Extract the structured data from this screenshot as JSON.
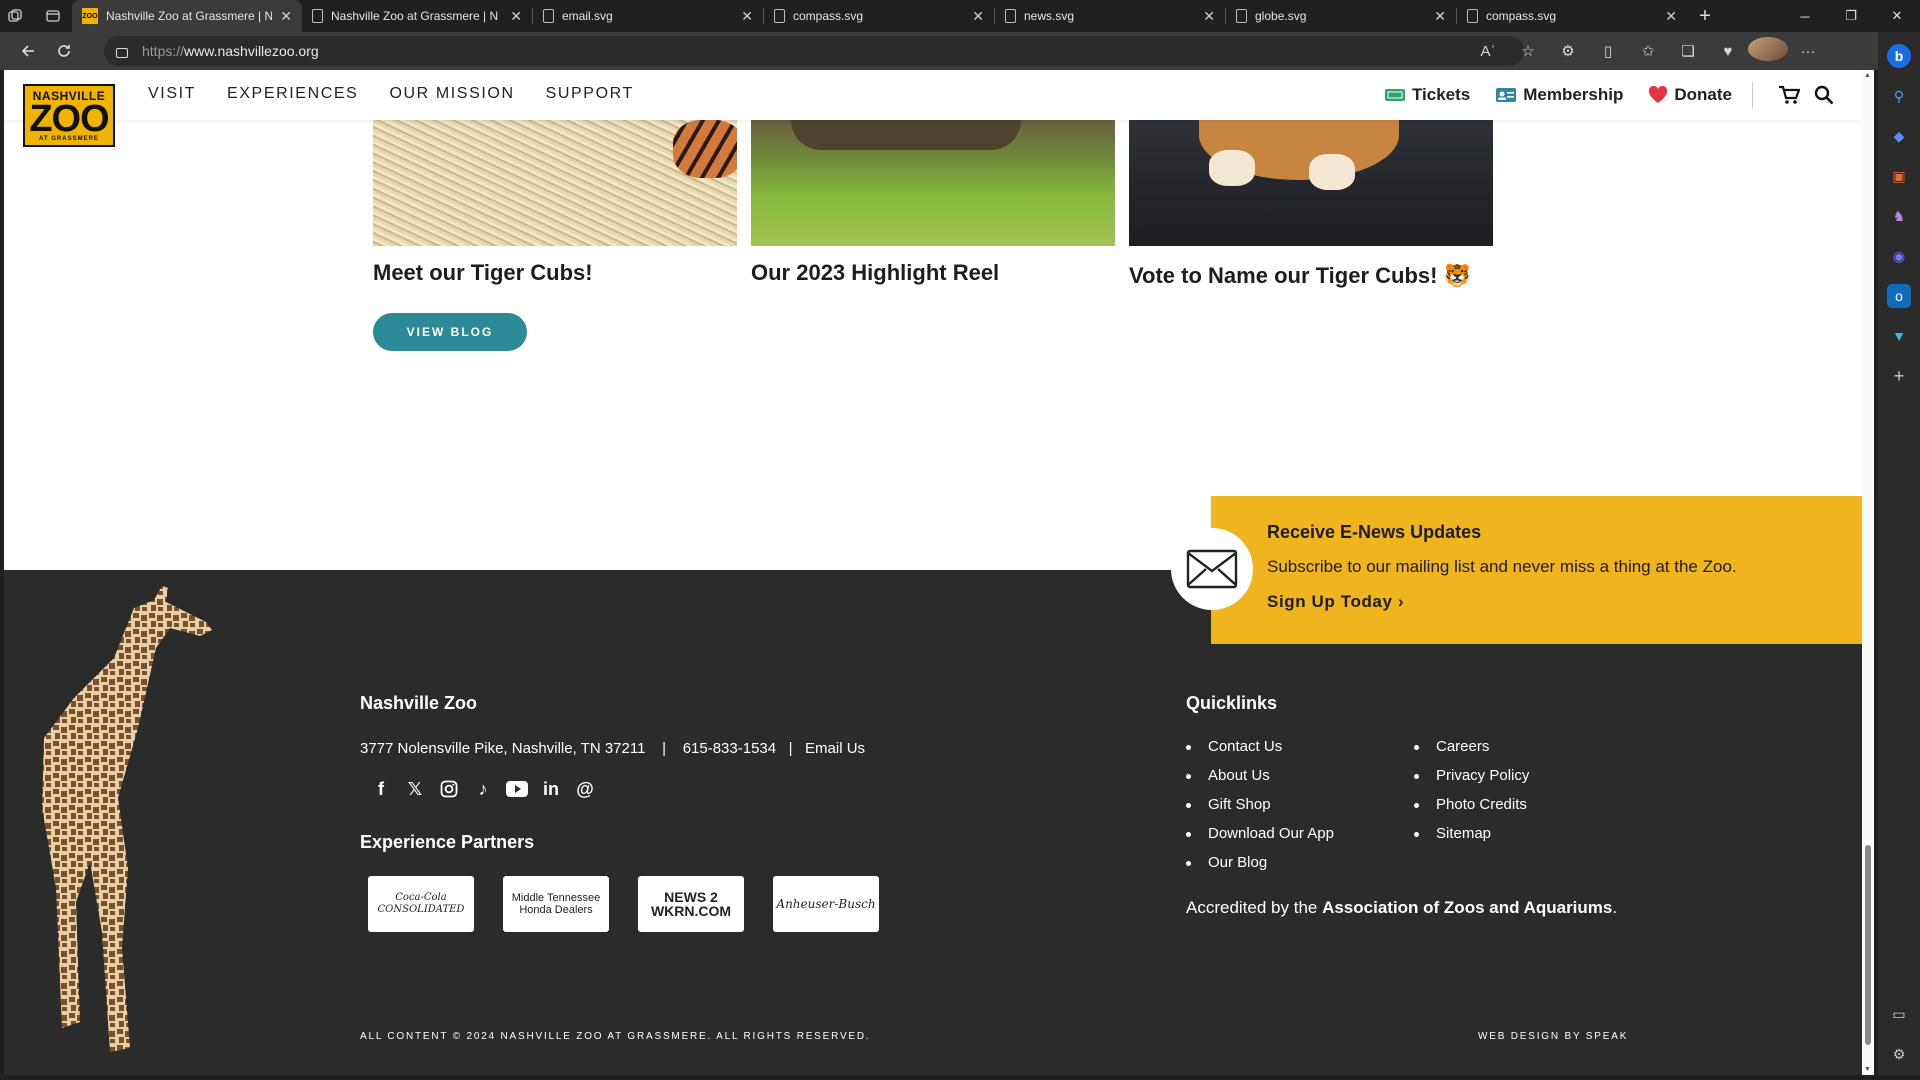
{
  "browser": {
    "tabs": [
      {
        "title": "Nashville Zoo at Grassmere | N",
        "favicon": "zoo-favicon",
        "active": true
      },
      {
        "title": "Nashville Zoo at Grassmere | N",
        "favicon": "page-icon",
        "active": false
      },
      {
        "title": "email.svg",
        "favicon": "page-icon",
        "active": false
      },
      {
        "title": "compass.svg",
        "favicon": "page-icon",
        "active": false
      },
      {
        "title": "news.svg",
        "favicon": "page-icon",
        "active": false
      },
      {
        "title": "globe.svg",
        "favicon": "page-icon",
        "active": false
      },
      {
        "title": "compass.svg",
        "favicon": "page-icon",
        "active": false
      }
    ],
    "url_protocol": "https://",
    "url_host": "www.nashvillezoo.org",
    "read_aloud_glyph": "Aʾ"
  },
  "header": {
    "logo": {
      "line1": "NASHVILLE",
      "line2": "ZOO",
      "line3": "AT GRASSMERE"
    },
    "nav": [
      "VISIT",
      "EXPERIENCES",
      "OUR MISSION",
      "SUPPORT"
    ],
    "tickets": "Tickets",
    "membership": "Membership",
    "donate": "Donate"
  },
  "blog": {
    "cards": [
      {
        "title": "Meet our Tiger Cubs!"
      },
      {
        "title": "Our 2023 Highlight Reel"
      },
      {
        "title": "Vote to Name our Tiger Cubs! 🐯"
      }
    ],
    "view_button": "VIEW BLOG"
  },
  "enews": {
    "heading": "Receive E-News Updates",
    "text": "Subscribe to our mailing list and never miss a thing at the Zoo.",
    "cta": "Sign Up Today"
  },
  "footer": {
    "org_name": "Nashville Zoo",
    "address": "3777 Nolensville Pike, Nashville, TN 37211",
    "phone": "615-833-1534",
    "email_link": "Email Us",
    "partners_heading": "Experience Partners",
    "partners": [
      "Coca-Cola CONSOLIDATED",
      "Middle Tennessee Honda Dealers",
      "NEWS 2 WKRN.COM",
      "Anheuser-Busch"
    ],
    "quicklinks_heading": "Quicklinks",
    "quicklinks_col1": [
      "Contact Us",
      "About Us",
      "Gift Shop",
      "Download Our App",
      "Our Blog"
    ],
    "quicklinks_col2": [
      "Careers",
      "Privacy Policy",
      "Photo Credits",
      "Sitemap"
    ],
    "accredited_prefix": "Accredited by the ",
    "accredited_org": "Association of Zoos and Aquariums",
    "accredited_suffix": ".",
    "copyright": "ALL CONTENT © 2024 NASHVILLE ZOO AT GRASSMERE. ALL RIGHTS RESERVED.",
    "credit": "WEB DESIGN BY SPEAK"
  },
  "colors": {
    "brand_yellow": "#f0b41f",
    "teal_button": "#2c8a96",
    "footer_bg": "#2b2b2b",
    "heart_red": "#e4343f",
    "membership_blue": "#2b88a0",
    "tickets_green": "#2fa36b"
  }
}
